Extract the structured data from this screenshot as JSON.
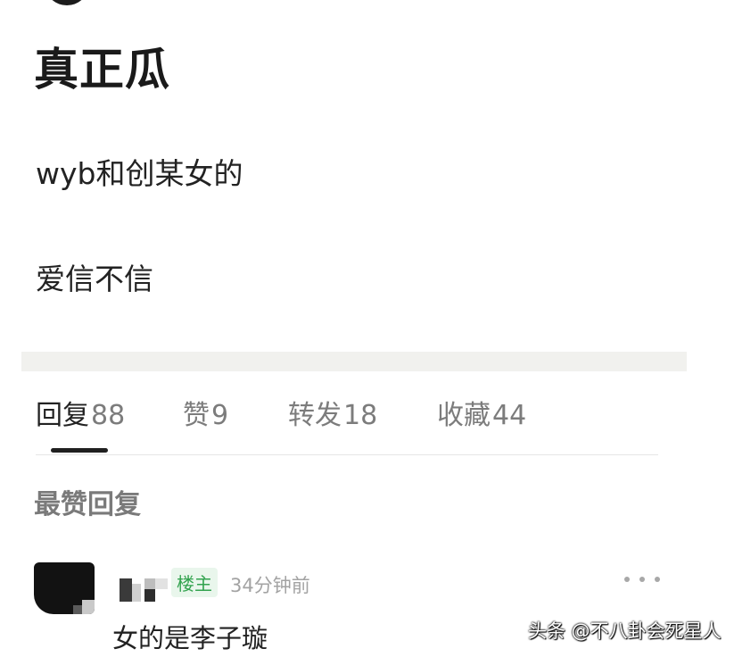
{
  "post": {
    "title": "真正瓜",
    "lines": [
      "wyb和创某女的",
      "爱信不信"
    ]
  },
  "tabs": [
    {
      "label": "回复",
      "count": "88",
      "active": true
    },
    {
      "label": "赞",
      "count": "9",
      "active": false
    },
    {
      "label": "转发",
      "count": "18",
      "active": false
    },
    {
      "label": "收藏",
      "count": "44",
      "active": false
    }
  ],
  "section": {
    "heading": "最赞回复"
  },
  "reply": {
    "badge": "楼主",
    "time": "34分钟前",
    "text": "女的是李子璇"
  },
  "watermark": "头条 @不八卦会死星人",
  "colors": {
    "accent_green": "#33a34f",
    "divider": "#f1f1ee"
  }
}
